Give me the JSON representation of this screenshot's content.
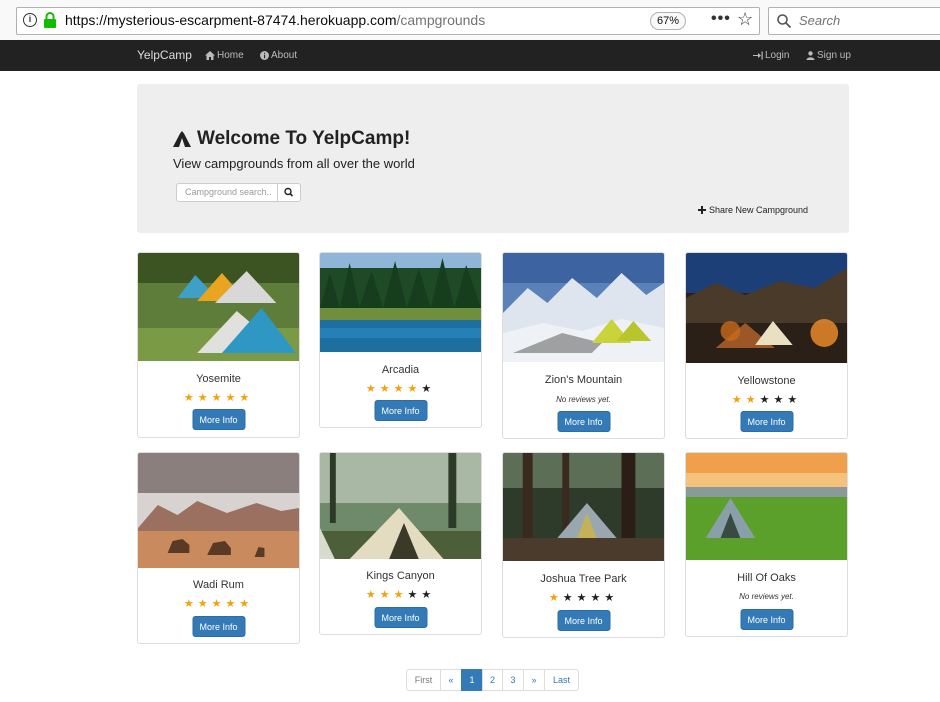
{
  "browser": {
    "url_host": "https://mysterious-escarpment-87474.herokuapp.com",
    "url_path": "/campgrounds",
    "zoom": "67%",
    "search_placeholder": "Search"
  },
  "navbar": {
    "brand": "YelpCamp",
    "home": "Home",
    "about": "About",
    "login": "Login",
    "signup": "Sign up"
  },
  "jumbotron": {
    "title": "Welcome To YelpCamp!",
    "subtitle": "View campgrounds from all over the world",
    "search_placeholder": "Campground search..",
    "share_label": "Share New Campground"
  },
  "more_info_label": "More Info",
  "campgrounds": [
    {
      "name": "Yosemite",
      "rating": 5,
      "no_reviews": ""
    },
    {
      "name": "Arcadia",
      "rating": 4,
      "no_reviews": ""
    },
    {
      "name": "Zion's Mountain",
      "rating": 0,
      "no_reviews": "No reviews yet."
    },
    {
      "name": "Yellowstone",
      "rating": 2,
      "no_reviews": ""
    },
    {
      "name": "Wadi Rum",
      "rating": 5,
      "no_reviews": ""
    },
    {
      "name": "Kings Canyon",
      "rating": 3,
      "no_reviews": ""
    },
    {
      "name": "Joshua Tree Park",
      "rating": 1,
      "no_reviews": ""
    },
    {
      "name": "Hill Of Oaks",
      "rating": 0,
      "no_reviews": "No reviews yet."
    }
  ],
  "pagination": {
    "first": "First",
    "prev": "«",
    "pages": [
      "1",
      "2",
      "3"
    ],
    "current": "1",
    "next": "»",
    "last": "Last"
  }
}
